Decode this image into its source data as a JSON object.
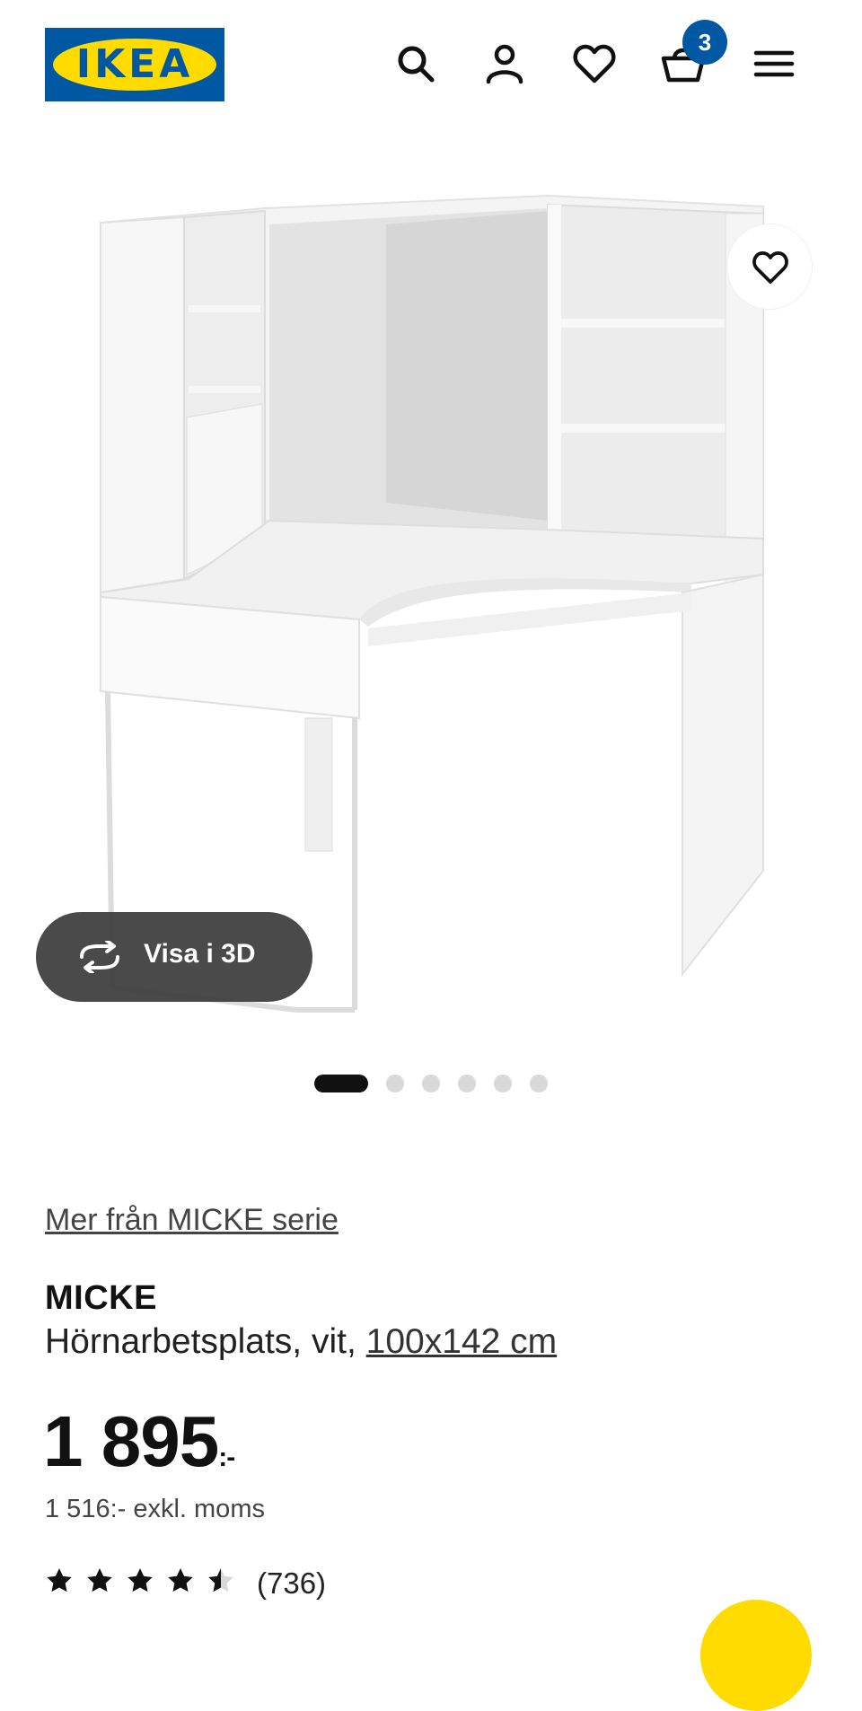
{
  "header": {
    "logo_text": "IKEA",
    "cart_count": "3",
    "icons": [
      "search-icon",
      "account-icon",
      "heart-icon",
      "basket-icon",
      "menu-icon"
    ]
  },
  "gallery": {
    "view_3d_label": "Visa i 3D",
    "slides_total": 6,
    "active_slide": 1
  },
  "product": {
    "series_link": "Mer från MICKE serie",
    "name": "MICKE",
    "desc_prefix": "Hörnarbetsplats, vit, ",
    "size_link": "100x142 cm",
    "price_main": "1 895",
    "price_suffix": ":-",
    "price_excl": "1 516:- exkl. moms",
    "rating_value": 4.5,
    "rating_count": "(736)"
  },
  "colors": {
    "ikea_blue": "#0058a3",
    "ikea_yellow": "#ffdb00",
    "button_dark": "#3c3c3c"
  }
}
